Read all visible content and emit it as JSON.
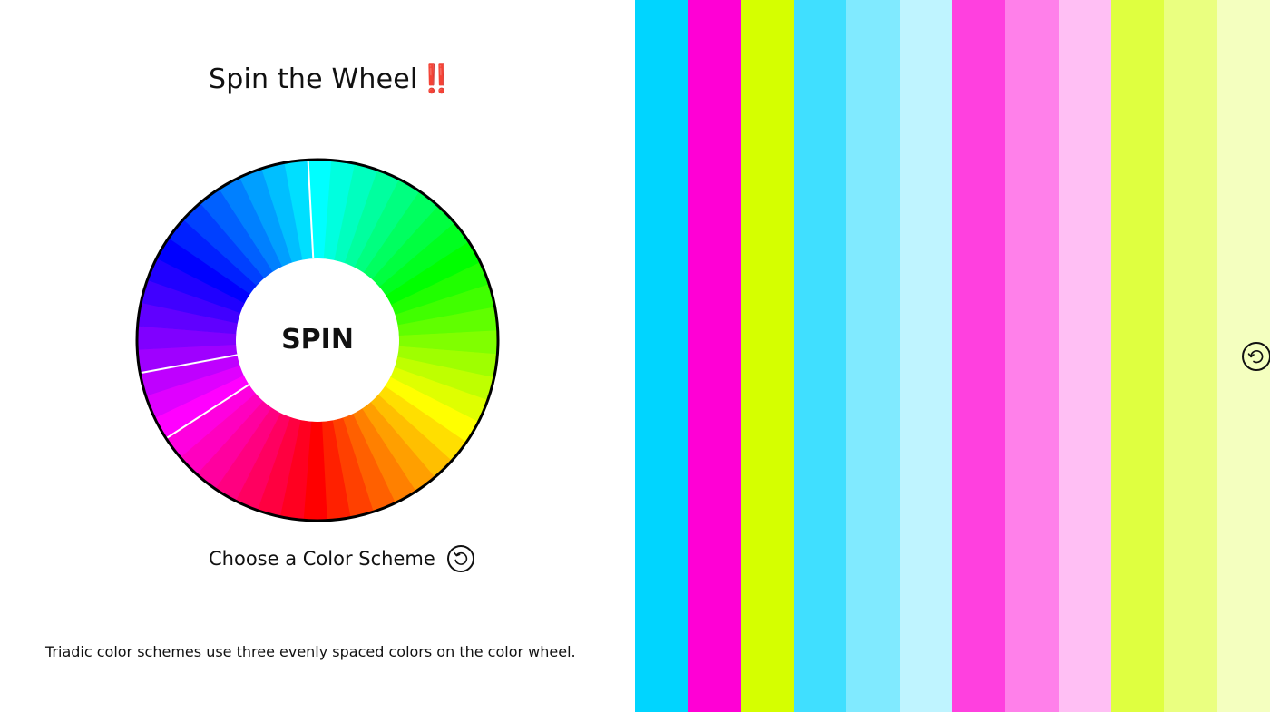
{
  "header": {
    "title": "Spin the Wheel",
    "title_emphasis": "‼️"
  },
  "wheel": {
    "center_label": "SPIN",
    "segment_count": 48,
    "border_color": "#000000",
    "separator_color": "#ffffff",
    "icon": "color-wheel"
  },
  "scheme": {
    "label": "Choose a Color Scheme",
    "refresh_icon": "refresh-icon"
  },
  "description": "Triadic color schemes use three evenly spaced colors on the color wheel.",
  "palette": {
    "colors": [
      "#00d5ff",
      "#ff00d5",
      "#d5ff00",
      "#40dfff",
      "#80eaff",
      "#bff4ff",
      "#ff40df",
      "#ff80ea",
      "#ffbff4",
      "#dfff40",
      "#eaff80",
      "#f4ffbf"
    ],
    "refresh_icon": "undo-icon"
  }
}
